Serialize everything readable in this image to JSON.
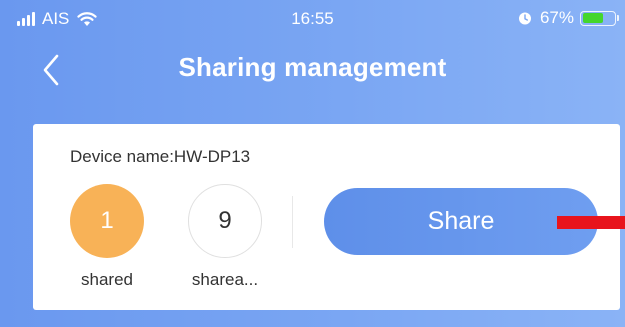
{
  "status_bar": {
    "carrier": "AIS",
    "time": "16:55",
    "battery_percent": "67%",
    "battery_level": 0.67,
    "icons": [
      "signal-icon",
      "wifi-icon",
      "alarm-icon",
      "battery-icon"
    ]
  },
  "nav": {
    "back_icon": "chevron-left-icon",
    "title": "Sharing management"
  },
  "card": {
    "device_name": "Device name:HW-DP13",
    "shared": {
      "count": "1",
      "label": "shared"
    },
    "shareable": {
      "count": "9",
      "label": "sharea..."
    },
    "share_button_label": "Share"
  },
  "colors": {
    "background": "#7aa6f3",
    "shared_circle": "#f8b257",
    "share_button": "#6590ec",
    "marker": "#e8141c"
  }
}
